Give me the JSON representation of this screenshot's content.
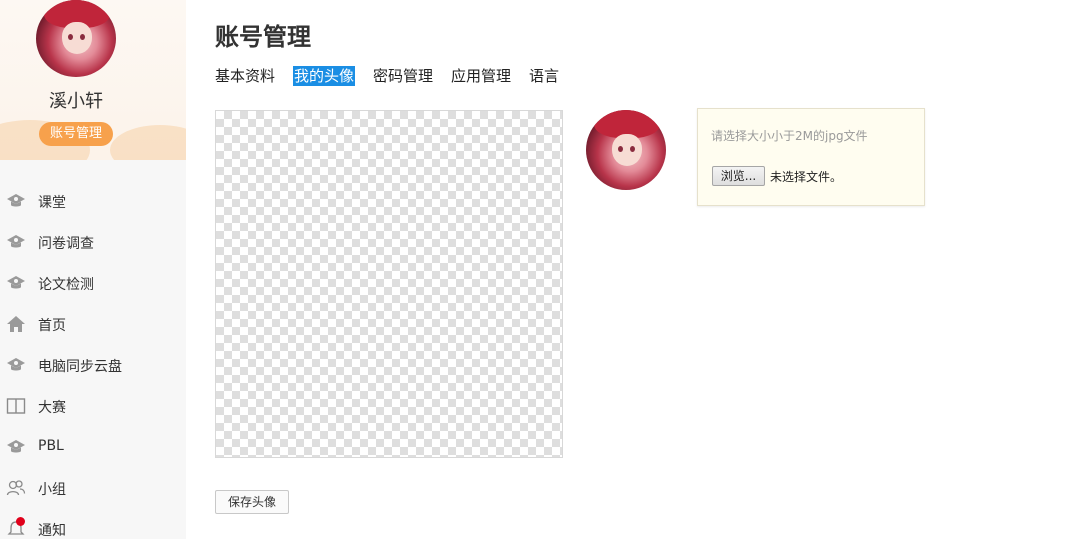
{
  "header": {
    "title": "账号管理"
  },
  "profile": {
    "name": "溪小轩",
    "badge": "账号管理"
  },
  "sidebar": {
    "items": [
      {
        "label": "课堂",
        "icon": "graduation-cap-icon"
      },
      {
        "label": "问卷调查",
        "icon": "graduation-cap-icon"
      },
      {
        "label": "论文检测",
        "icon": "graduation-cap-icon"
      },
      {
        "label": "首页",
        "icon": "home-icon"
      },
      {
        "label": "电脑同步云盘",
        "icon": "graduation-cap-icon"
      },
      {
        "label": "大赛",
        "icon": "book-icon"
      },
      {
        "label": "PBL",
        "icon": "graduation-cap-icon"
      },
      {
        "label": "小组",
        "icon": "group-icon"
      },
      {
        "label": "通知",
        "icon": "bell-icon",
        "has_notification_dot": true
      }
    ]
  },
  "tabs": [
    {
      "label": "基本资料",
      "active": false
    },
    {
      "label": "我的头像",
      "active": true
    },
    {
      "label": "密码管理",
      "active": false
    },
    {
      "label": "应用管理",
      "active": false
    },
    {
      "label": "语言",
      "active": false
    }
  ],
  "upload": {
    "hint": "请选择大小小于2M的jpg文件",
    "browse_label": "浏览...",
    "no_file_text": "未选择文件。"
  },
  "actions": {
    "save_label": "保存头像"
  },
  "colors": {
    "accent_tab": "#1a8ee4",
    "badge": "#f7a14c",
    "notification_dot": "#e0001b",
    "upload_box_bg": "#fffdf0"
  }
}
